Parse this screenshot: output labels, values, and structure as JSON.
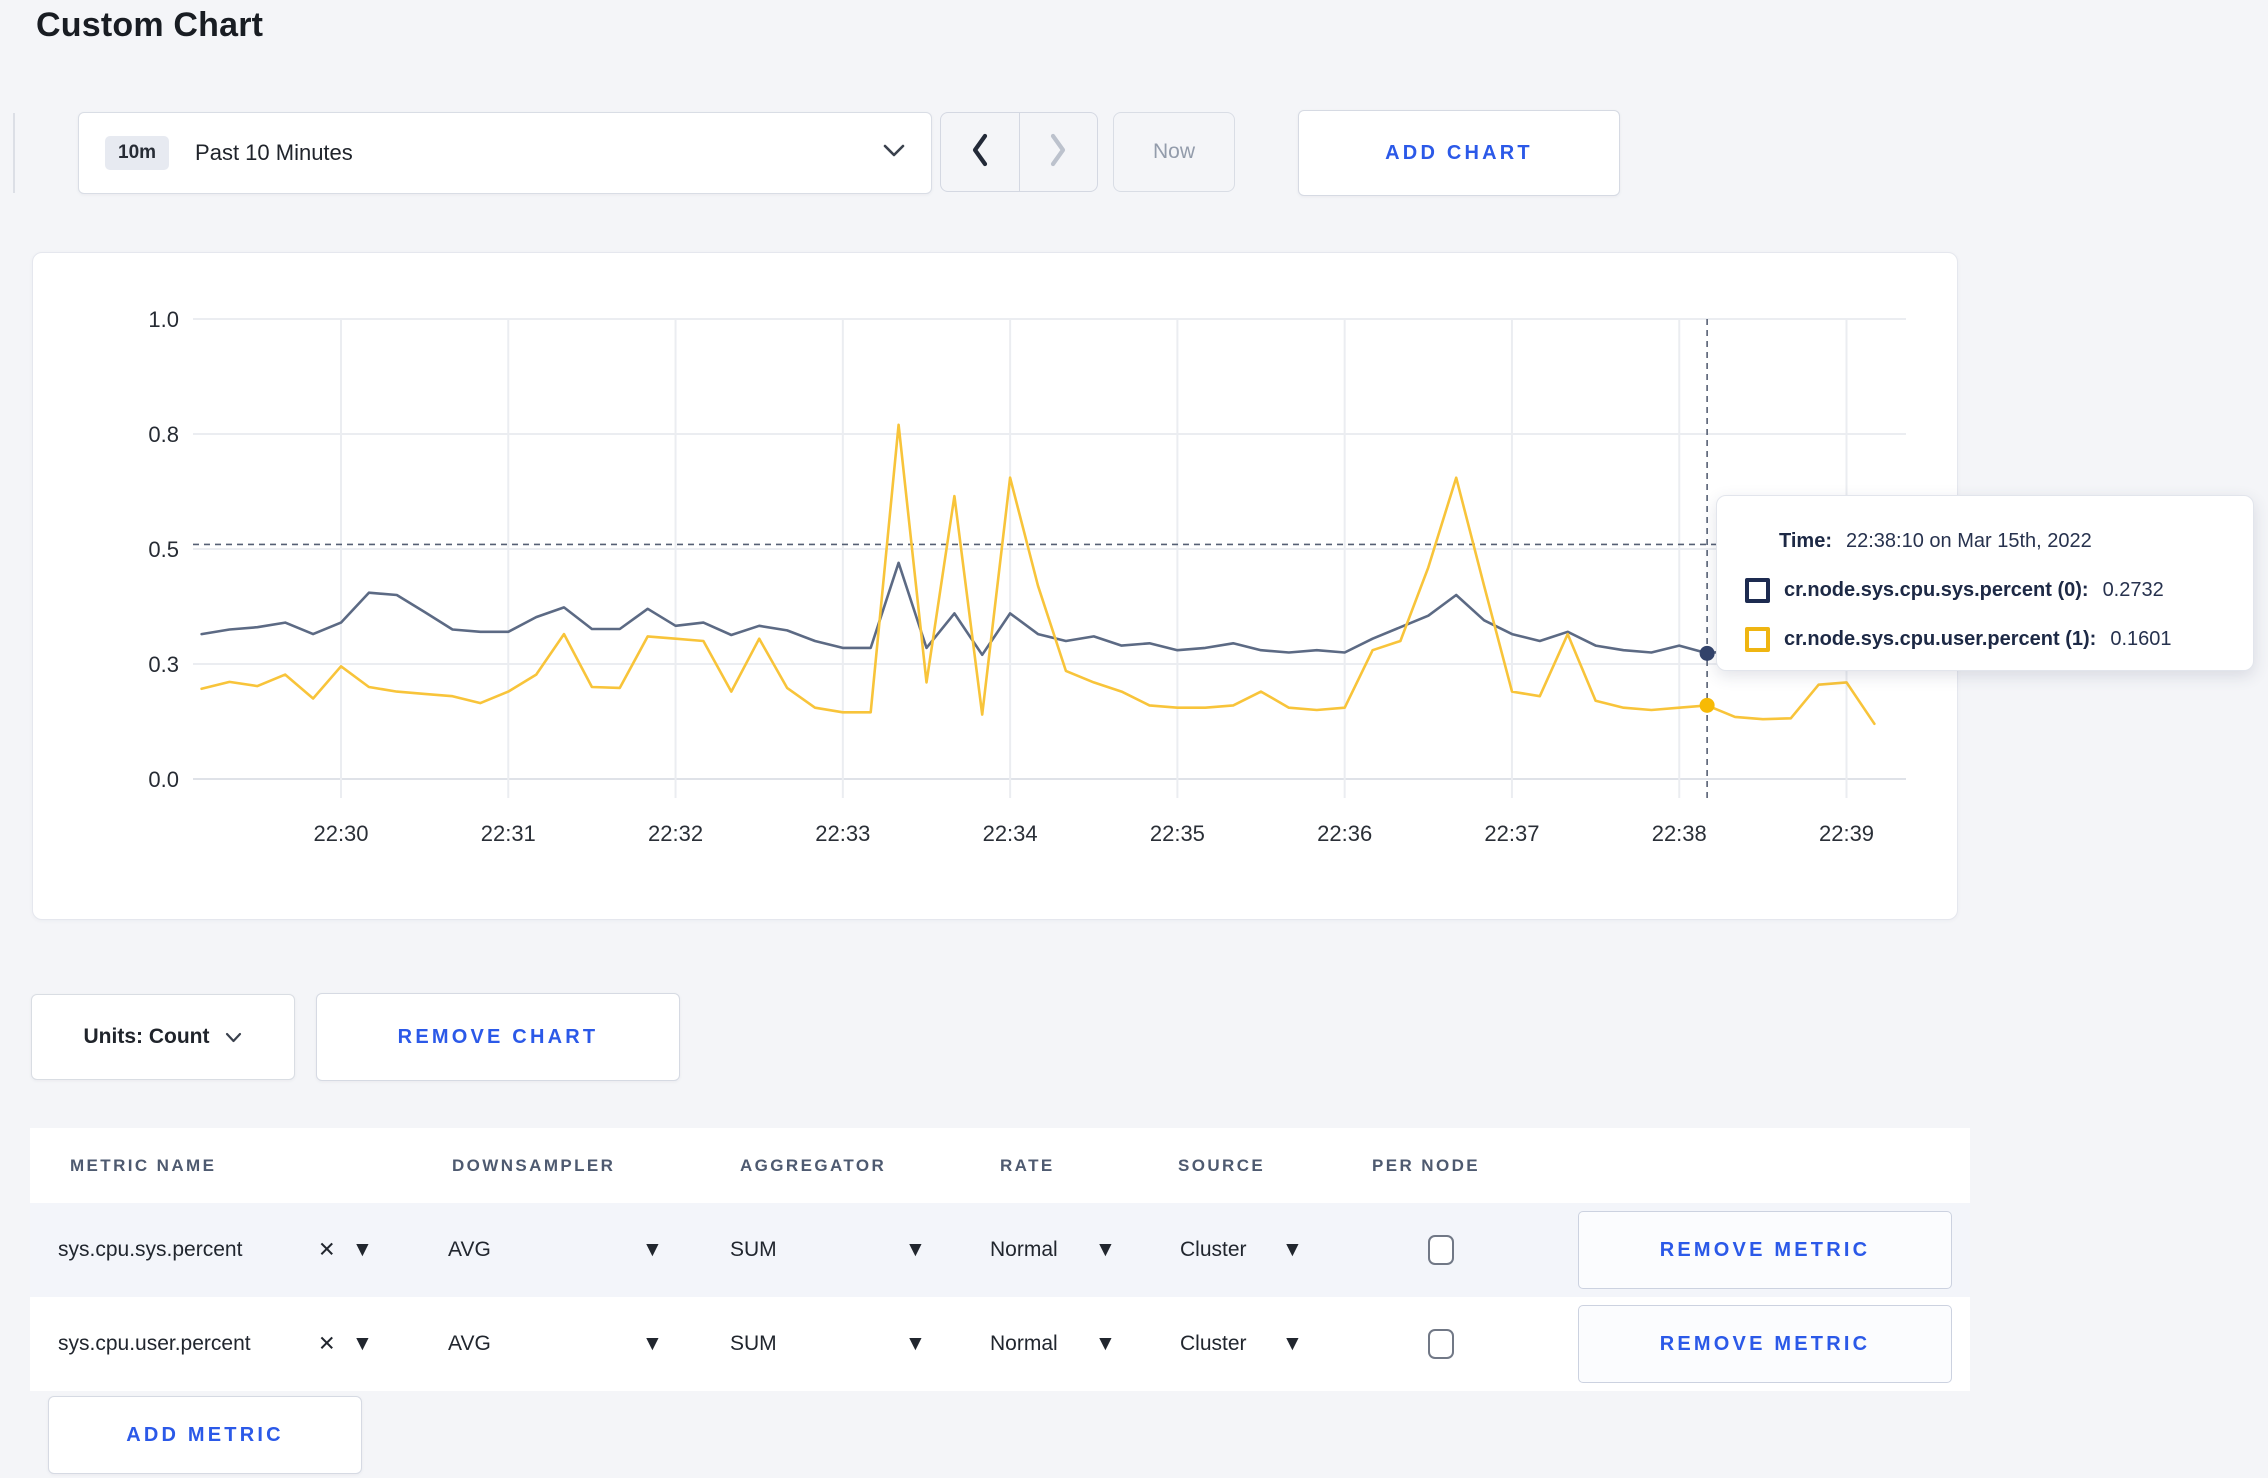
{
  "page": {
    "title": "Custom Chart"
  },
  "toolbar": {
    "time_badge": "10m",
    "time_label": "Past 10 Minutes",
    "now_label": "Now",
    "add_chart_label": "ADD CHART"
  },
  "chart_controls": {
    "units_label": "Units: Count",
    "remove_chart_label": "REMOVE CHART"
  },
  "chart_data": {
    "type": "line",
    "title": "",
    "xlabel": "",
    "ylabel": "",
    "grid": true,
    "sample_interval_seconds": 10,
    "duration_seconds": 600,
    "x_ticks": [
      {
        "t": 50,
        "label": "22:30"
      },
      {
        "t": 110,
        "label": "22:31"
      },
      {
        "t": 170,
        "label": "22:32"
      },
      {
        "t": 230,
        "label": "22:33"
      },
      {
        "t": 290,
        "label": "22:34"
      },
      {
        "t": 350,
        "label": "22:35"
      },
      {
        "t": 410,
        "label": "22:36"
      },
      {
        "t": 470,
        "label": "22:37"
      },
      {
        "t": 530,
        "label": "22:38"
      },
      {
        "t": 590,
        "label": "22:39"
      }
    ],
    "y_axis": {
      "min": 0,
      "max": 1,
      "gridline_values": [
        0,
        0.25,
        0.5,
        0.75,
        1
      ],
      "tick_labels": [
        "0.0",
        "0.3",
        "0.5",
        "0.8",
        "1.0"
      ]
    },
    "series": [
      {
        "name": "cr.node.sys.cpu.sys.percent",
        "color": "#5c6a84",
        "values": [
          0.315,
          0.325,
          0.33,
          0.34,
          0.315,
          0.34,
          0.405,
          0.4,
          0.363,
          0.325,
          0.32,
          0.32,
          0.352,
          0.373,
          0.326,
          0.326,
          0.37,
          0.333,
          0.34,
          0.313,
          0.333,
          0.323,
          0.3,
          0.285,
          0.285,
          0.47,
          0.285,
          0.36,
          0.27,
          0.36,
          0.315,
          0.3,
          0.31,
          0.29,
          0.295,
          0.28,
          0.285,
          0.295,
          0.28,
          0.275,
          0.28,
          0.275,
          0.305,
          0.33,
          0.355,
          0.4,
          0.345,
          0.315,
          0.3,
          0.32,
          0.29,
          0.28,
          0.275,
          0.29,
          0.2732,
          0.28,
          0.285,
          0.295,
          0.29,
          0.295,
          0.29
        ]
      },
      {
        "name": "cr.node.sys.cpu.user.percent",
        "color": "#f8c43a",
        "values": [
          0.196,
          0.211,
          0.202,
          0.227,
          0.175,
          0.245,
          0.2,
          0.19,
          0.185,
          0.18,
          0.165,
          0.19,
          0.227,
          0.315,
          0.2,
          0.198,
          0.31,
          0.305,
          0.3,
          0.19,
          0.305,
          0.198,
          0.155,
          0.145,
          0.145,
          0.77,
          0.21,
          0.615,
          0.14,
          0.655,
          0.42,
          0.235,
          0.21,
          0.19,
          0.16,
          0.155,
          0.155,
          0.16,
          0.19,
          0.155,
          0.15,
          0.155,
          0.28,
          0.3,
          0.46,
          0.655,
          0.42,
          0.19,
          0.18,
          0.315,
          0.17,
          0.155,
          0.15,
          0.155,
          0.1601,
          0.135,
          0.13,
          0.132,
          0.205,
          0.21,
          0.12
        ]
      }
    ],
    "hover": {
      "t": 540,
      "guide_y_value": 0.51,
      "points": [
        {
          "series": 0,
          "value": 0.2732,
          "dot_color": "#33436b"
        },
        {
          "series": 1,
          "value": 0.1601,
          "dot_color": "#f7ba05"
        }
      ]
    }
  },
  "tooltip": {
    "time_label": "Time:",
    "time_value": "22:38:10 on Mar 15th, 2022",
    "rows": [
      {
        "swatch_color": "#1d2b50",
        "name": "cr.node.sys.cpu.sys.percent (0):",
        "value": "0.2732"
      },
      {
        "swatch_color": "#efb511",
        "name": "cr.node.sys.cpu.user.percent (1):",
        "value": "0.1601"
      }
    ]
  },
  "metrics_table": {
    "headers": [
      "METRIC NAME",
      "DOWNSAMPLER",
      "AGGREGATOR",
      "RATE",
      "SOURCE",
      "PER NODE"
    ],
    "rows": [
      {
        "metric": "sys.cpu.sys.percent",
        "downsampler": "AVG",
        "aggregator": "SUM",
        "rate": "Normal",
        "source": "Cluster",
        "per_node_checked": false,
        "remove_label": "REMOVE METRIC"
      },
      {
        "metric": "sys.cpu.user.percent",
        "downsampler": "AVG",
        "aggregator": "SUM",
        "rate": "Normal",
        "source": "Cluster",
        "per_node_checked": false,
        "remove_label": "REMOVE METRIC"
      }
    ],
    "add_metric_label": "ADD METRIC"
  },
  "icons": {
    "caret_down": "▼",
    "close": "✕"
  }
}
